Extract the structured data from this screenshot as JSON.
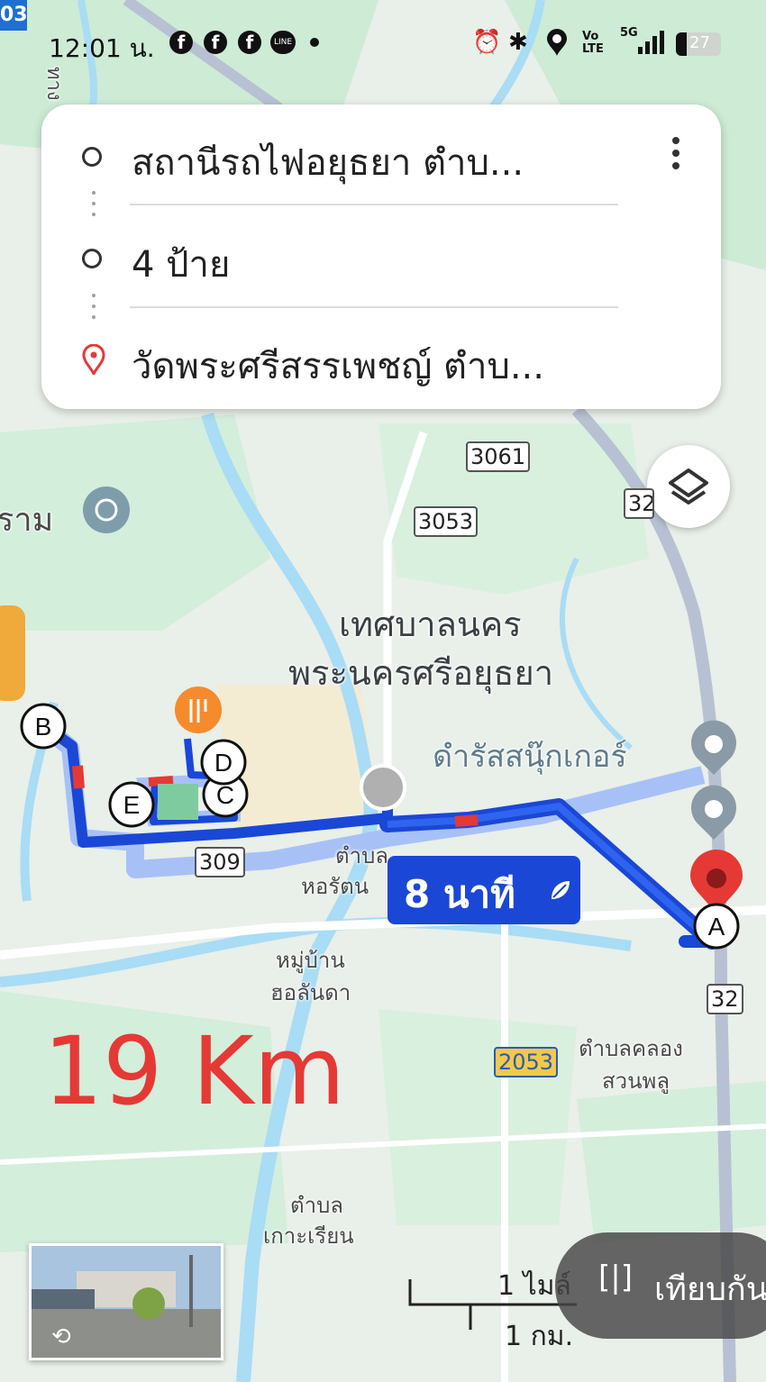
{
  "status_bar": {
    "time": "12:01 น.",
    "network": "5G",
    "battery": "27",
    "volte": "Vo LTE",
    "icons": [
      "facebook-icon",
      "facebook-icon",
      "facebook-icon",
      "line-icon",
      "alarm-icon",
      "bluetooth-icon",
      "location-icon",
      "volte-icon",
      "signal-icon",
      "battery-icon"
    ]
  },
  "directions": {
    "origin": "สถานีรถไฟอยุธยา ตำบ...",
    "stops": "4 ป้าย",
    "destination": "วัดพระศรีสรรเพชญ์ ตำบ..."
  },
  "map_labels": {
    "city_line1": "เทศบาลนคร",
    "city_line2": "พระนครศรีอยุธยา",
    "tumbon_horatana_1": "ตำบล",
    "tumbon_horatana_2": "หอรัตน",
    "village_1": "หมู่บ้าน",
    "village_2": "ฮอลันดา",
    "klongsuanplu_1": "ตำบลคลอง",
    "klongsuanplu_2": "สวนพลู",
    "koriang_1": "ตำบล",
    "koriang_2": "เกาะเรียน",
    "temple_partial": "ราม",
    "poi_right": "ดำรัสสนุ๊กเกอร์",
    "corner_badge": "03",
    "road_top": "ทาง"
  },
  "road_shields": [
    "3061",
    "3053",
    "32",
    "309",
    "32",
    "2053"
  ],
  "stops": [
    "A",
    "B",
    "C",
    "D",
    "E"
  ],
  "route": {
    "eta": "8 นาที",
    "distance_note": "19 Km"
  },
  "scale": {
    "miles": "1 ไมล์",
    "km": "1 กม."
  },
  "compare_button": "เทียบกัน",
  "colors": {
    "route_blue": "#1a47d6",
    "route_light": "#a7c1f7",
    "water": "#a9dcf5",
    "park": "#c9ecd2",
    "pin_red": "#e53935",
    "distance_red": "#e53935"
  }
}
